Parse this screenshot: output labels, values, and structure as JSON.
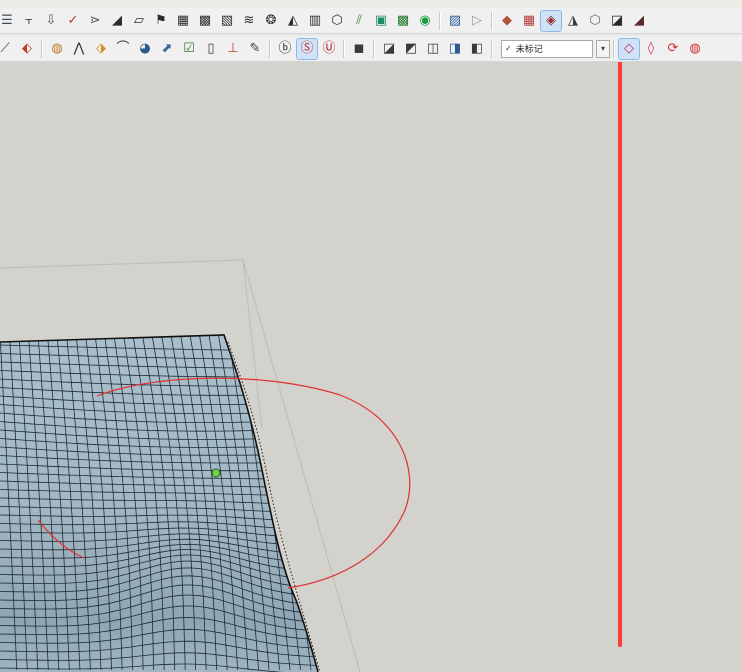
{
  "window": {
    "background": "#d3d2cc"
  },
  "toolbar_top": {
    "tools": [
      {
        "icon": "extrude-lines-icon",
        "color": "#3a4a5a",
        "glyph": "☰"
      },
      {
        "icon": "drop-tool-icon",
        "color": "#3b3b3b",
        "glyph": "⫟"
      },
      {
        "icon": "down-arrow-tool-icon",
        "color": "#505050",
        "glyph": "⇩"
      },
      {
        "icon": "spline-tool-icon",
        "color": "#c0392b",
        "glyph": "✓"
      },
      {
        "icon": "branch-tool-icon",
        "color": "#555555",
        "glyph": "⋗"
      },
      {
        "icon": "roof-tool-icon",
        "color": "#2d2d2d",
        "glyph": "◢"
      },
      {
        "icon": "panel-tool-icon",
        "color": "#2d2d2d",
        "glyph": "▱"
      },
      {
        "icon": "flag-tool-icon",
        "color": "#2d2d2d",
        "glyph": "⚑"
      },
      {
        "icon": "wall-tool-icon",
        "color": "#2d2d2d",
        "glyph": "▦"
      },
      {
        "icon": "grid-tool-icon",
        "color": "#2d2d2d",
        "glyph": "▩"
      },
      {
        "icon": "stripes-tool-icon",
        "color": "#2d2d2d",
        "glyph": "▧"
      },
      {
        "icon": "wave-tool-icon",
        "color": "#2d2d2d",
        "glyph": "≋"
      },
      {
        "icon": "shell-tool-icon",
        "color": "#2d2d2d",
        "glyph": "❂"
      },
      {
        "icon": "comb-tool-icon",
        "color": "#2d2d2d",
        "glyph": "◭"
      },
      {
        "icon": "lattice-tool-icon",
        "color": "#2d2d2d",
        "glyph": "▥"
      },
      {
        "icon": "cube-outline-icon",
        "color": "#2d2d2d",
        "glyph": "⬡"
      },
      {
        "icon": "slice-tool-icon",
        "color": "#3a8f3a",
        "glyph": "⫽"
      },
      {
        "icon": "teal-box-icon",
        "color": "#1a8a6a",
        "glyph": "▣"
      },
      {
        "icon": "green-box-icon",
        "color": "#1f7a2a",
        "glyph": "▩"
      },
      {
        "icon": "green-circle-icon",
        "color": "#1a9a3a",
        "glyph": "◉"
      }
    ],
    "tools_b": [
      {
        "icon": "image-tool-icon",
        "color": "#2a5a9a",
        "glyph": "▨"
      },
      {
        "icon": "eraser-arrow-icon",
        "color": "#9a9a9a",
        "glyph": "▷"
      }
    ],
    "tools_c": [
      {
        "icon": "terrain-tool-icon",
        "color": "#b0533a",
        "glyph": "◆"
      },
      {
        "icon": "grid-surface-icon",
        "color": "#b03a3a",
        "glyph": "▦"
      },
      {
        "icon": "sandbox-drape-icon",
        "color": "#9a2a2a",
        "glyph": "◈",
        "active": true
      },
      {
        "icon": "sandbox-stamp-icon",
        "color": "#3a3a3a",
        "glyph": "◮"
      },
      {
        "icon": "sandbox-add-icon",
        "color": "#6a6a6a",
        "glyph": "⬡"
      },
      {
        "icon": "sandbox-flip-icon",
        "color": "#2a2a2a",
        "glyph": "◪"
      },
      {
        "icon": "sandbox-detail-icon",
        "color": "#5a2a2a",
        "glyph": "◢"
      }
    ]
  },
  "toolbar_bottom": {
    "tools": [
      {
        "icon": "pencil-tool-icon",
        "color": "#3a3a3a",
        "glyph": "⟋"
      },
      {
        "icon": "paint-tool-icon",
        "color": "#c03a2a",
        "glyph": "⬖"
      }
    ],
    "tools_b": [
      {
        "icon": "book-tool-icon",
        "color": "#c07a2a",
        "glyph": "◍"
      },
      {
        "icon": "sweep-tool-icon",
        "color": "#2a2a2a",
        "glyph": "⋀"
      },
      {
        "icon": "stairs-tool-icon",
        "color": "#d0902a",
        "glyph": "⬗"
      },
      {
        "icon": "arc-tool-icon",
        "color": "#3a3a3a",
        "glyph": "⌒"
      },
      {
        "icon": "sphere-tool-icon",
        "color": "#2a5a8a",
        "glyph": "◕"
      },
      {
        "icon": "arrow-tool-icon",
        "color": "#3a6a9a",
        "glyph": "⬈"
      },
      {
        "icon": "check-box-tool-icon",
        "color": "#3a7a3a",
        "glyph": "☑"
      },
      {
        "icon": "door-tool-icon",
        "color": "#3a3a3a",
        "glyph": "▯"
      },
      {
        "icon": "pin-tool-icon",
        "color": "#c03a2a",
        "glyph": "⊥"
      },
      {
        "icon": "brush-tool-icon",
        "color": "#3a3a3a",
        "glyph": "✎"
      }
    ],
    "tools_c": [
      {
        "icon": "plugin-3b-icon",
        "color": "#2a2a2a",
        "glyph": "ⓑ"
      },
      {
        "icon": "plugin-s-icon",
        "color": "#d02a2a",
        "glyph": "Ⓢ",
        "active": true
      },
      {
        "icon": "plugin-su-app-icon",
        "color": "#b02020",
        "glyph": "Ⓤ"
      }
    ],
    "tools_d": [
      {
        "icon": "component-tool-icon",
        "color": "#3a3a3a",
        "glyph": "◼"
      }
    ],
    "tools_e": [
      {
        "icon": "component-a-icon",
        "color": "#3a3a3a",
        "glyph": "◪"
      },
      {
        "icon": "component-b-icon",
        "color": "#3a3a3a",
        "glyph": "◩"
      },
      {
        "icon": "component-c-icon",
        "color": "#3a3a3a",
        "glyph": "◫"
      },
      {
        "icon": "component-d-icon",
        "color": "#2a5a9a",
        "glyph": "◨"
      },
      {
        "icon": "component-e-icon",
        "color": "#3a3a3a",
        "glyph": "◧"
      }
    ],
    "tag_select": {
      "check": "✓",
      "value": "未标记",
      "arrow": "▾"
    },
    "tools_f": [
      {
        "icon": "ruby-gem-icon",
        "color": "#d02a5a",
        "glyph": "◇",
        "active": true
      },
      {
        "icon": "ruby-gem-outline-icon",
        "color": "#d02a5a",
        "glyph": "◊"
      },
      {
        "icon": "ruby-refresh-icon",
        "color": "#d02a2a",
        "glyph": "⟳"
      },
      {
        "icon": "ruby-extra-icon",
        "color": "#d02a2a",
        "glyph": "◍"
      }
    ]
  },
  "annotation": {
    "color": "#ff3b3b"
  }
}
